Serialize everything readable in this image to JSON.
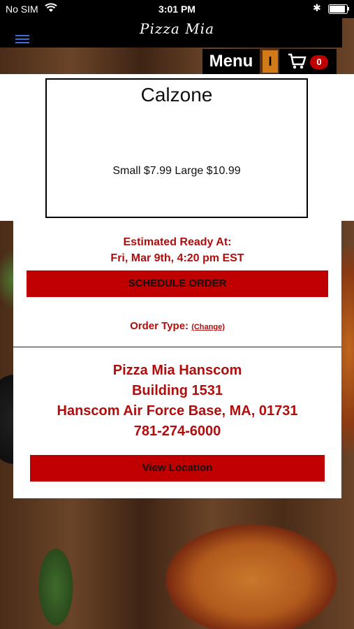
{
  "status_bar": {
    "carrier": "No SIM",
    "time": "3:01 PM"
  },
  "header": {
    "brand": "Pizza Mia",
    "menu_label": "Menu",
    "indicator": "I",
    "cart_count": "0"
  },
  "product": {
    "name": "Calzone",
    "price_text": "Small $7.99  Large $10.99"
  },
  "order": {
    "estimated_label": "Estimated Ready At:",
    "estimated_time": "Fri, Mar 9th, 4:20 pm EST",
    "schedule_button": "SCHEDULE ORDER",
    "order_type_label": "Order Type:",
    "change_link": "(Change)"
  },
  "location": {
    "name": "Pizza Mia Hanscom",
    "building": "Building 1531",
    "city_line": "Hanscom Air Force Base, MA, 01731",
    "phone": "781-274-6000",
    "view_button": "View Location"
  },
  "colors": {
    "accent_red": "#c00000",
    "text_red": "#b00d0d",
    "bar_black": "#000000",
    "indicator_orange": "#d07a1a"
  }
}
